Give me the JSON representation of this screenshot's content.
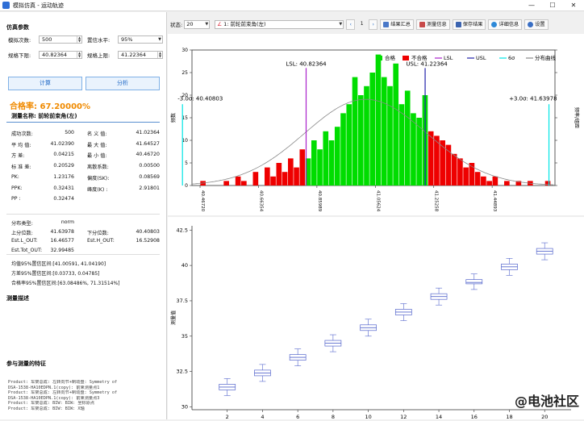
{
  "window": {
    "title": "模拟仿真 - 运动轨迹",
    "minimize": "—",
    "maximize": "☐",
    "close": "✕"
  },
  "left": {
    "sim_params_title": "仿真参数",
    "sim_count_label": "模拟次数:",
    "sim_count_value": "500",
    "conf_level_label": "置信水平:",
    "conf_level_value": "95%",
    "lsl_label": "规格下限:",
    "lsl_value": "40.82364",
    "usl_label": "规格上限:",
    "usl_value": "41.22364",
    "calc_button": "计算",
    "analyze_button": "分析",
    "pass_rate": "合格率: 67.20000%",
    "measure_name": "测量名称: 前轮前束角(左)",
    "stats": [
      [
        "成功次数:",
        "500",
        "名 义 值:",
        "41.02364"
      ],
      [
        "平 均 值:",
        "41.02390",
        "最 大 值:",
        "41.64527"
      ],
      [
        "方    差:",
        "0.04215",
        "最 小 值:",
        "40.46720"
      ],
      [
        "标 准 差:",
        "0.20529",
        "离散系数:",
        "0.00500"
      ],
      [
        "PK:",
        "1.23176",
        "偏度(SK):",
        "0.08569"
      ],
      [
        "PPK:",
        "0.32431",
        "峰度(K) :",
        "2.91801"
      ],
      [
        "PP :",
        "0.32474",
        "",
        ""
      ]
    ],
    "dist": [
      [
        "分布类型:",
        "norm",
        "",
        ""
      ],
      [
        "上分位数:",
        "41.63978",
        "下分位数:",
        "40.40803"
      ],
      [
        "Est.L_OUT:",
        "16.46577",
        "Est.H_OUT:",
        "16.52908"
      ],
      [
        "Est.Tot_OUT:",
        "32.99485",
        "",
        ""
      ]
    ],
    "ci": [
      "均值95%置信区间:[41.00591, 41.04190]",
      "方差95%置信区间:[0.03733, 0.04785]",
      "合格率95%置信区间:[63.08486%, 71.31514%]"
    ],
    "measure_desc_title": "测量描述",
    "features_title": "参与测量的特征",
    "features": [
      "Product: 车架总成: 左转向节+制动盘: Symmetry of",
      "DSA-1538-HA10EDPN.1(copy): 前束测量点1",
      "Product: 车架总成: 左转向节+制动盘: Symmetry of",
      "DSA-1538-HA10EDPN.1(copy): 前束测量点3",
      "Product: 车架总成: BIW: BIW: 坐标原点",
      "Product: 车架总成: BIW: BIW: X轴"
    ]
  },
  "toolbar": {
    "state_label": "状态:",
    "state_value": "20",
    "measure_value": "1: 前轮前束角(左)",
    "page": "1",
    "prev": "‹",
    "next": "›",
    "summary": "结果汇总",
    "measure_info": "测量信息",
    "save": "保存结果",
    "detail": "详细信息",
    "settings": "设置"
  },
  "hist_text": {
    "lsl_label": "LSL: 40.82364",
    "usl_label": "USL: 41.22364",
    "low_3s": "-3.0σ: 40.40803",
    "high_3s": "+3.0σ: 41.63978",
    "ylabel_left": "频数",
    "ylabel_right": "频率/组距",
    "legend": [
      "合格",
      "不合格",
      "LSL",
      "USL",
      "6σ",
      "分布曲线"
    ]
  },
  "chart_data": [
    {
      "type": "bar",
      "ylabel": "频数",
      "ylim": [
        0,
        30
      ],
      "yticks": [
        0,
        5,
        10,
        15,
        20,
        25,
        30
      ],
      "xlim": [
        40.44,
        41.66
      ],
      "xticks": [
        "40.46720",
        "40.66354",
        "40.85989",
        "41.05624",
        "41.25258",
        "41.44893"
      ],
      "bin_start": 40.4672,
      "bin_width": 0.01964,
      "values": [
        1,
        0,
        0,
        0,
        1,
        0,
        2,
        1,
        0,
        3,
        0,
        4,
        2,
        5,
        3,
        6,
        4,
        8,
        6,
        10,
        8,
        12,
        10,
        13,
        16,
        18,
        24,
        20,
        22,
        25,
        29,
        24,
        22,
        27,
        18,
        21,
        16,
        15,
        20,
        12,
        11,
        10,
        9,
        7,
        6,
        4,
        5,
        3,
        2,
        1,
        2,
        0,
        1,
        0,
        1,
        0,
        1,
        0,
        0,
        1
      ],
      "lsl": 40.82364,
      "usl": 41.22364,
      "sigma_low": 40.40803,
      "sigma_high": 41.63978,
      "colors": {
        "pass": "#00dd00",
        "fail": "#ee0000",
        "lsl": "#aa22cc",
        "usl": "#2222aa",
        "sigma": "#00e5e5",
        "curve": "#888888"
      },
      "legend_position": "top-right",
      "series": [
        {
          "name": "合格"
        },
        {
          "name": "不合格"
        },
        {
          "name": "LSL"
        },
        {
          "name": "USL"
        },
        {
          "name": "6σ"
        },
        {
          "name": "分布曲线"
        }
      ]
    },
    {
      "type": "box",
      "ylabel": "测量值",
      "ylim": [
        29.8,
        42.8
      ],
      "yticks": [
        30,
        32.5,
        35,
        37.5,
        40,
        42.5
      ],
      "x": [
        2,
        4,
        6,
        8,
        10,
        12,
        14,
        16,
        18,
        20
      ],
      "boxes": [
        {
          "min": 30.8,
          "q1": 31.2,
          "median": 31.4,
          "q3": 31.6,
          "max": 32.0
        },
        {
          "min": 31.8,
          "q1": 32.2,
          "median": 32.4,
          "q3": 32.6,
          "max": 33.0
        },
        {
          "min": 32.9,
          "q1": 33.3,
          "median": 33.5,
          "q3": 33.7,
          "max": 34.1
        },
        {
          "min": 33.9,
          "q1": 34.3,
          "median": 34.5,
          "q3": 34.7,
          "max": 35.1
        },
        {
          "min": 35.0,
          "q1": 35.4,
          "median": 35.6,
          "q3": 35.8,
          "max": 36.2
        },
        {
          "min": 36.1,
          "q1": 36.5,
          "median": 36.7,
          "q3": 36.9,
          "max": 37.3
        },
        {
          "min": 37.2,
          "q1": 37.6,
          "median": 37.8,
          "q3": 38.0,
          "max": 38.4
        },
        {
          "min": 38.3,
          "q1": 38.7,
          "median": 38.8,
          "q3": 39.0,
          "max": 39.4
        },
        {
          "min": 39.3,
          "q1": 39.7,
          "median": 39.9,
          "q3": 40.1,
          "max": 40.5
        },
        {
          "min": 40.4,
          "q1": 40.8,
          "median": 41.0,
          "q3": 41.2,
          "max": 41.6
        }
      ],
      "colors": {
        "box": "#5566cc",
        "whisker": "#5566cc"
      }
    }
  ],
  "watermark": "@电池社区"
}
